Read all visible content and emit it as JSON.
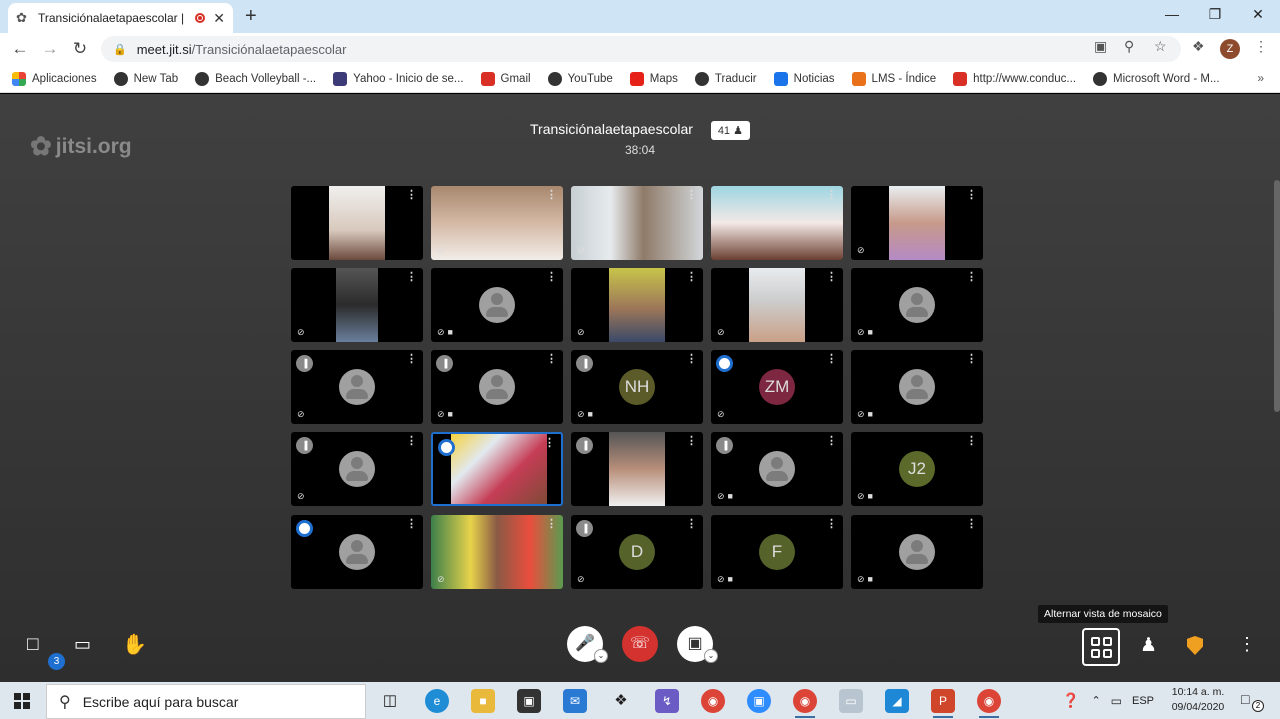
{
  "browser": {
    "tab_title": "Transiciónalaetapaescolar | J",
    "url_host": "meet.jit.si",
    "url_path": "/Transiciónalaetapaescolar",
    "profile_initial": "Z"
  },
  "bookmarks": [
    {
      "label": "Aplicaciones",
      "icon": "apps-grid-icon",
      "color": "#e8453c"
    },
    {
      "label": "New Tab",
      "icon": "globe-icon",
      "color": "#333333"
    },
    {
      "label": "Beach Volleyball -...",
      "icon": "globe-icon",
      "color": "#333333"
    },
    {
      "label": "Yahoo - Inicio de se...",
      "icon": "yahoo-icon",
      "color": "#3d3a78"
    },
    {
      "label": "Gmail",
      "icon": "gmail-icon",
      "color": "#d93025"
    },
    {
      "label": "YouTube",
      "icon": "globe-icon",
      "color": "#333333"
    },
    {
      "label": "Maps",
      "icon": "youtube-icon",
      "color": "#e62117"
    },
    {
      "label": "Traducir",
      "icon": "globe-icon",
      "color": "#333333"
    },
    {
      "label": "Noticias",
      "icon": "gif-icon",
      "color": "#1a73e8"
    },
    {
      "label": "LMS - Índice",
      "icon": "lms-icon",
      "color": "#e8711a"
    },
    {
      "label": "http://www.conduc...",
      "icon": "gmail-icon",
      "color": "#d93025"
    },
    {
      "label": "Microsoft Word - M...",
      "icon": "globe-icon",
      "color": "#333333"
    }
  ],
  "jitsi": {
    "logo_text": "jitsi.org",
    "conference_name": "Transiciónalaetapaescolar",
    "participant_count": "41",
    "duration": "38:04",
    "tooltip": "Alternar vista de mosaico",
    "chat_unread": "3"
  },
  "tiles": [
    {
      "kind": "video",
      "status": "",
      "label": ""
    },
    {
      "kind": "video",
      "status": "mic-off",
      "label": ""
    },
    {
      "kind": "video",
      "status": "mic-off",
      "label": ""
    },
    {
      "kind": "video",
      "status": "",
      "label": ""
    },
    {
      "kind": "video",
      "status": "mic-off",
      "label": ""
    },
    {
      "kind": "video",
      "status": "mic-off",
      "label": ""
    },
    {
      "kind": "avatar",
      "status": "mic-off cam-off",
      "label": ""
    },
    {
      "kind": "video",
      "status": "mic-off",
      "label": ""
    },
    {
      "kind": "video",
      "status": "mic-off",
      "label": ""
    },
    {
      "kind": "avatar",
      "status": "mic-off cam-off",
      "label": ""
    },
    {
      "kind": "avatar",
      "status": "mic-off",
      "label": ""
    },
    {
      "kind": "avatar",
      "status": "mic-off cam-off",
      "label": ""
    },
    {
      "kind": "initials",
      "status": "mic-off cam-off",
      "label": "NH",
      "color": "#5b5b2a"
    },
    {
      "kind": "initials",
      "status": "mic-off",
      "label": "ZM",
      "color": "#7d2840"
    },
    {
      "kind": "avatar",
      "status": "mic-off cam-off",
      "label": ""
    },
    {
      "kind": "avatar",
      "status": "mic-off",
      "label": ""
    },
    {
      "kind": "video",
      "status": "",
      "label": ""
    },
    {
      "kind": "video",
      "status": "",
      "label": ""
    },
    {
      "kind": "avatar",
      "status": "mic-off cam-off",
      "label": ""
    },
    {
      "kind": "initials",
      "status": "mic-off cam-off",
      "label": "J2",
      "color": "#5b6a2a"
    },
    {
      "kind": "avatar",
      "status": "",
      "label": ""
    },
    {
      "kind": "video",
      "status": "mic-off",
      "label": ""
    },
    {
      "kind": "initials",
      "status": "mic-off",
      "label": "D",
      "color": "#55632b"
    },
    {
      "kind": "initials",
      "status": "mic-off cam-off",
      "label": "F",
      "color": "#55632b"
    },
    {
      "kind": "avatar",
      "status": "mic-off cam-off",
      "label": ""
    }
  ],
  "taskbar": {
    "search_placeholder": "Escribe aquí para buscar",
    "language": "ESP",
    "time": "10:14 a. m.",
    "date": "09/04/2020",
    "notifications": "2"
  }
}
